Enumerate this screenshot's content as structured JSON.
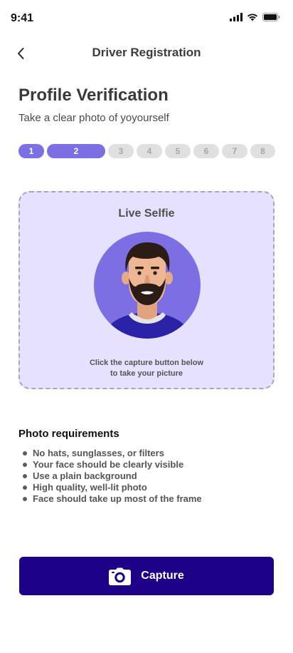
{
  "status_bar": {
    "time": "9:41",
    "icons": [
      "signal-icon",
      "wifi-icon",
      "battery-icon"
    ]
  },
  "header": {
    "back_icon": "chevron-left-icon",
    "title": "Driver Registration"
  },
  "page": {
    "title": "Profile Verification",
    "subtitle": "Take a clear photo of yoyourself"
  },
  "stepper": {
    "current_step": 2,
    "steps": [
      {
        "label": "1",
        "state": "complete"
      },
      {
        "label": "2",
        "state": "active"
      },
      {
        "label": "3",
        "state": "upcoming"
      },
      {
        "label": "4",
        "state": "upcoming"
      },
      {
        "label": "5",
        "state": "upcoming"
      },
      {
        "label": "6",
        "state": "upcoming"
      },
      {
        "label": "7",
        "state": "upcoming"
      },
      {
        "label": "8",
        "state": "upcoming"
      }
    ],
    "colors": {
      "active": "#7b6fe3",
      "inactive": "#e0e0e0"
    }
  },
  "selfie": {
    "title": "Live Selfie",
    "avatar_icon": "driver-avatar-illustration",
    "instructions_line1": "Click the capture button below",
    "instructions_line2": "to take your picture",
    "card_color": "#e5e1ff"
  },
  "requirements": {
    "title": "Photo requirements",
    "items": [
      "No hats, sunglasses, or filters",
      "Your face should be clearly visible",
      "Use a plain background",
      "High quality, well-lit photo",
      "Face should take up most of the frame"
    ]
  },
  "capture": {
    "label": "Capture",
    "icon": "camera-icon",
    "color": "#1c0086"
  }
}
